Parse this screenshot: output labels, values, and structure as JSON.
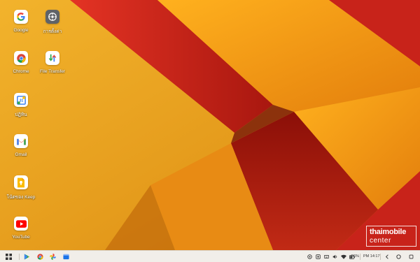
{
  "desktop": {
    "icons": [
      {
        "label": "Google",
        "icon": "google-icon"
      },
      {
        "label": "การตั้งค่า",
        "icon": "settings-icon"
      },
      {
        "label": "Chrome",
        "icon": "chrome-icon"
      },
      {
        "label": "File Transfer",
        "icon": "file-transfer-icon"
      },
      {
        "label": "ปฏิทิน",
        "icon": "calendar-icon"
      },
      {
        "label": "Gmail",
        "icon": "gmail-icon"
      },
      {
        "label": "โน้ตของ Keep",
        "icon": "keep-icon"
      },
      {
        "label": "YouTube",
        "icon": "youtube-icon"
      }
    ],
    "calendar_day": "31"
  },
  "taskbar": {
    "start_icon": "start-grid-icon",
    "pinned_apps": [
      "play-store-icon",
      "chrome-icon",
      "photos-icon",
      "files-icon"
    ],
    "tray": {
      "battery_percent": "56%",
      "clock": "PM 14:17"
    }
  },
  "watermark": {
    "line1": "thaimobile",
    "line2": "center"
  },
  "colors": {
    "wallpaper_yellow": "#e9a21f",
    "wallpaper_red": "#c8231a",
    "wallpaper_orange": "#f39a12",
    "taskbar_bg": "#f1eee9"
  }
}
